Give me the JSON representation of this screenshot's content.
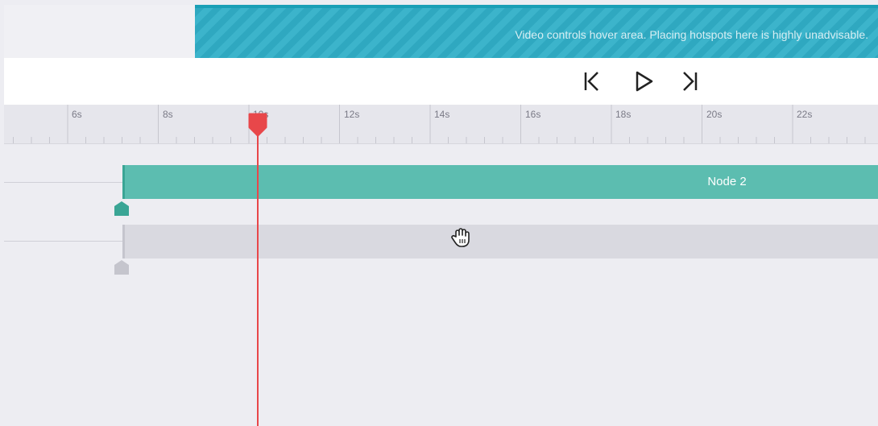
{
  "hover_area": {
    "message": "Video controls hover area. Placing hotspots here is highly unadvisable."
  },
  "controls": {
    "skip_start_icon": "skip-to-start-icon",
    "play_icon": "play-icon",
    "skip_end_icon": "skip-to-end-icon"
  },
  "ruler": {
    "labels": [
      "6s",
      "8s",
      "10s",
      "12s",
      "14s",
      "16s",
      "18s",
      "20s",
      "22s"
    ]
  },
  "tracks": [
    {
      "label": "Node 2",
      "color": "#5cbdb0"
    },
    {
      "label": "",
      "color": "#d9d9e0"
    }
  ],
  "playhead": {
    "time": "10s",
    "color": "#e8474a"
  },
  "colors": {
    "accent": "#2fa8c0",
    "node": "#5cbdb0",
    "playhead": "#e8474a"
  }
}
